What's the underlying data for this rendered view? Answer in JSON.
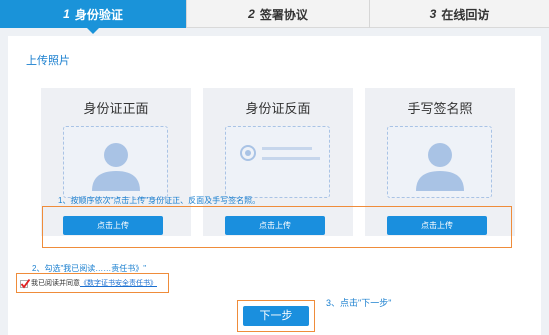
{
  "steps": [
    {
      "num": "1",
      "label": "身份验证",
      "active": true
    },
    {
      "num": "2",
      "label": "签署协议",
      "active": false
    },
    {
      "num": "3",
      "label": "在线回访",
      "active": false
    }
  ],
  "section_title": "上传照片",
  "cards": [
    {
      "title": "身份证正面",
      "button": "点击上传",
      "icon": "person-silhouette-icon"
    },
    {
      "title": "身份证反面",
      "button": "点击上传",
      "icon": "id-card-back-icon"
    },
    {
      "title": "手写签名照",
      "button": "点击上传",
      "icon": "person-silhouette-icon"
    }
  ],
  "hints": {
    "upload_order": "1、按顺序依次\"点击上传\"身份证正、反面及手写签名照。",
    "check_agree": "2、勾选\"我已阅读……责任书》\"",
    "click_next": "3、点击\"下一步\""
  },
  "agreement": {
    "prefix": "我已阅读并同意",
    "link": "《数字证书安全责任书》"
  },
  "next_button": "下一步",
  "colors": {
    "primary": "#1a93d9",
    "annotation_box": "#ef8c3a",
    "check_mark": "#e02020"
  }
}
